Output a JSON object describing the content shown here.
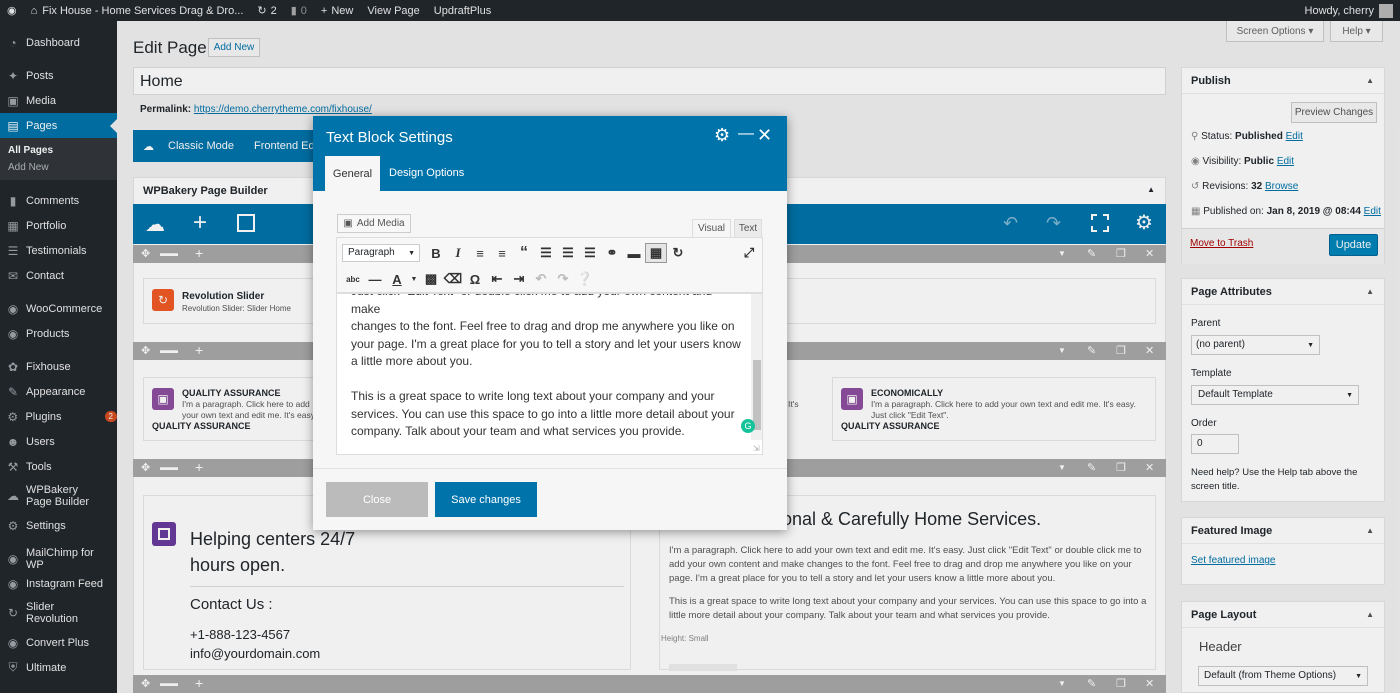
{
  "adminbar": {
    "site": "Fix House - Home Services Drag & Dro...",
    "updates": "2",
    "comments": "0",
    "new": "New",
    "view": "View Page",
    "updraft": "UpdraftPlus",
    "howdy": "Howdy, cherry"
  },
  "sidebar": {
    "items": [
      {
        "label": "Dashboard",
        "icon": "dashboard-icon"
      },
      {
        "label": "Posts",
        "icon": "pin-icon"
      },
      {
        "label": "Media",
        "icon": "media-icon"
      },
      {
        "label": "Pages",
        "icon": "pages-icon"
      },
      {
        "label": "Comments",
        "icon": "comments-icon"
      },
      {
        "label": "Portfolio",
        "icon": "portfolio-icon"
      },
      {
        "label": "Testimonials",
        "icon": "testimonials-icon"
      },
      {
        "label": "Contact",
        "icon": "mail-icon"
      },
      {
        "label": "WooCommerce",
        "icon": "woo-icon"
      },
      {
        "label": "Products",
        "icon": "products-icon"
      },
      {
        "label": "Fixhouse",
        "icon": "leaf-icon"
      },
      {
        "label": "Appearance",
        "icon": "brush-icon"
      },
      {
        "label": "Plugins",
        "icon": "plugin-icon",
        "badge": "2"
      },
      {
        "label": "Users",
        "icon": "users-icon"
      },
      {
        "label": "Tools",
        "icon": "tools-icon"
      },
      {
        "label": "WPBakery Page Builder",
        "icon": "wpbakery-icon"
      },
      {
        "label": "Settings",
        "icon": "settings-icon"
      },
      {
        "label": "MailChimp for WP",
        "icon": "mailchimp-icon"
      },
      {
        "label": "Instagram Feed",
        "icon": "instagram-icon"
      },
      {
        "label": "Slider Revolution",
        "icon": "slider-icon"
      },
      {
        "label": "Convert Plus",
        "icon": "convert-icon"
      },
      {
        "label": "Ultimate",
        "icon": "ultimate-icon"
      }
    ],
    "sub": {
      "all": "All Pages",
      "add": "Add New"
    }
  },
  "header": {
    "title": "Edit Page",
    "addnew": "Add New",
    "screen_options": "Screen Options ▾",
    "help": "Help ▾"
  },
  "editor": {
    "title_value": "Home",
    "permalink_label": "Permalink:",
    "permalink_url": "https://demo.cherrytheme.com/fixhouse/",
    "classic": "Classic Mode",
    "frontend": "Frontend Editor",
    "wpb_title": "WPBakery Page Builder"
  },
  "content": {
    "rev_title": "Revolution Slider",
    "rev_sub": "Revolution Slider: Slider Home",
    "qa_title": "QUALITY ASSURANCE",
    "qa_text": "I'm a paragraph. Click here to add your own text and edit me. It's easy. Just click \"Edit Text\".",
    "qa_label": "QUALITY ASSURANCE",
    "mid_text": "It's",
    "eco_title": "ECONOMICALLY",
    "eco_text": "I'm a paragraph. Click here to add your own text and edit me. It's easy. Just click \"Edit Text\".",
    "eco_label": "QUALITY ASSURANCE",
    "help_title": "Helping centers 24/7 hours open.",
    "contact_title": "Contact Us :",
    "phone": "+1-888-123-4567",
    "email": "info@yourdomain.com",
    "prof_title": "ssional & Carefully Home Services.",
    "p1": "I'm a paragraph. Click here to add your own text and edit me. It's easy. Just click \"Edit Text\" or double click me to add your own content and make changes to the font. Feel free to drag and drop me anywhere you like on your page. I'm a great place for you to tell a story and let your users know a little more about you.",
    "p2": "This is a great space to write long text about your company and your services. You can use this space to go into a little more detail about your company. Talk about your team and what services you provide.",
    "height_label": "Height: Small"
  },
  "publish": {
    "title": "Publish",
    "preview": "Preview Changes",
    "status_label": "Status:",
    "status": "Published",
    "edit": "Edit",
    "visibility_label": "Visibility:",
    "visibility": "Public",
    "revisions_label": "Revisions:",
    "revisions": "32",
    "browse": "Browse",
    "published_label": "Published on:",
    "published": "Jan 8, 2019 @ 08:44",
    "trash": "Move to Trash",
    "update": "Update"
  },
  "attributes": {
    "title": "Page Attributes",
    "parent_label": "Parent",
    "parent": "(no parent)",
    "template_label": "Template",
    "template": "Default Template",
    "order_label": "Order",
    "order": "0",
    "help": "Need help? Use the Help tab above the screen title."
  },
  "featured": {
    "title": "Featured Image",
    "set": "Set featured image"
  },
  "layout": {
    "title": "Page Layout",
    "header": "Header",
    "header_value": "Default (from Theme Options)"
  },
  "modal": {
    "title": "Text Block Settings",
    "tab_general": "General",
    "tab_design": "Design Options",
    "add_media": "Add Media",
    "visual": "Visual",
    "text": "Text",
    "format": "Paragraph",
    "t1": "Just click \"Edit Text\" or double click me to add your own content and make",
    "t2": "changes to the font. Feel free to drag and drop me anywhere you like on",
    "t3": "your page. I'm a great place for you to tell a story and let your users know",
    "t4": "a little more about you.",
    "t5": "This is a great space to write long text about your company and your",
    "t6": "services. You can use this space to go into a little more detail about your",
    "t7": "company. Talk about your team and what services you provide.",
    "close": "Close",
    "save": "Save changes"
  }
}
